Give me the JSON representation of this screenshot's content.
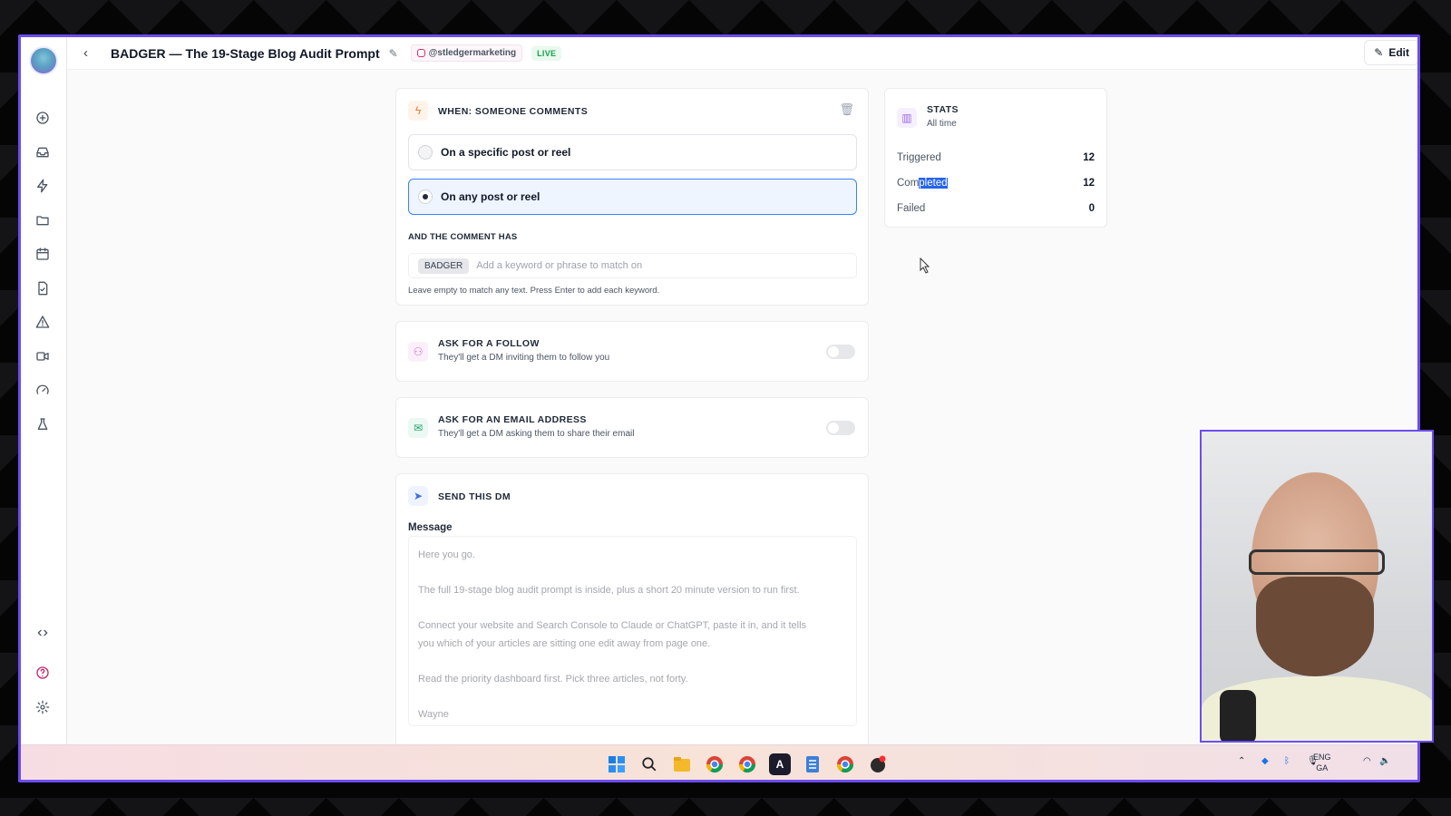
{
  "app": {
    "title": "BADGER — The 19-Stage Blog Audit Prompt",
    "account": "@stledgermarketing",
    "status": "LIVE",
    "edit_label": "Edit"
  },
  "trigger": {
    "title": "WHEN: SOMEONE COMMENTS",
    "options": [
      {
        "label": "On a specific post or reel",
        "selected": false
      },
      {
        "label": "On any post or reel",
        "selected": true
      }
    ],
    "comment_heading": "AND THE COMMENT HAS",
    "keyword_chip": "BADGER",
    "keyword_placeholder": "Add a keyword or phrase to match on",
    "keyword_help": "Leave empty to match any text. Press Enter to add each keyword."
  },
  "follow": {
    "title": "ASK FOR A FOLLOW",
    "subtitle": "They'll get a DM inviting them to follow you",
    "enabled": false
  },
  "email": {
    "title": "ASK FOR AN EMAIL ADDRESS",
    "subtitle": "They'll get a DM asking them to share their email",
    "enabled": false
  },
  "dm": {
    "title": "SEND THIS DM",
    "message_label": "Message",
    "lines": [
      "Here you go.",
      "The full 19-stage blog audit prompt is inside, plus a short 20 minute version to run first.",
      "Connect your website and Search Console to Claude or ChatGPT, paste it in, and it tells",
      "you which of your articles are sitting one edit away from page one.",
      "Read the priority dashboard first. Pick three articles, not forty.",
      "Wayne"
    ]
  },
  "stats": {
    "title": "STATS",
    "period": "All time",
    "rows": [
      {
        "label": "Triggered",
        "value": "12"
      },
      {
        "label_pre": "Com",
        "label_hl": "pleted",
        "value": "12"
      },
      {
        "label": "Failed",
        "value": "0"
      }
    ]
  },
  "taskbar": {
    "lang_top": "ENG",
    "lang_bottom": "GA"
  },
  "colors": {
    "accent": "#6d4cf0",
    "live_green": "#16a34a",
    "selected_blue": "#3b82f6"
  }
}
